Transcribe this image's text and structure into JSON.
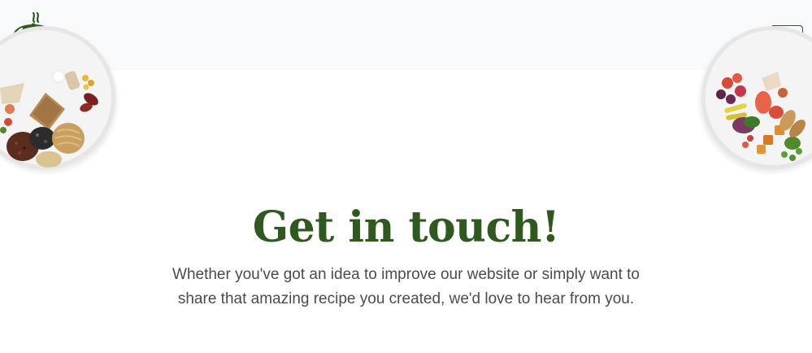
{
  "header": {
    "logo_icon": "serving-cloche-icon",
    "menu_icon": "hamburger-menu-icon",
    "accent_color": "#2f5a1f"
  },
  "decor": {
    "left_image": "food-plate-left",
    "right_image": "food-plate-right"
  },
  "hero": {
    "title": "Get in touch!",
    "description": "Whether you've got an idea to improve our website or simply want to share that amazing recipe you created, we'd love to hear from you."
  }
}
